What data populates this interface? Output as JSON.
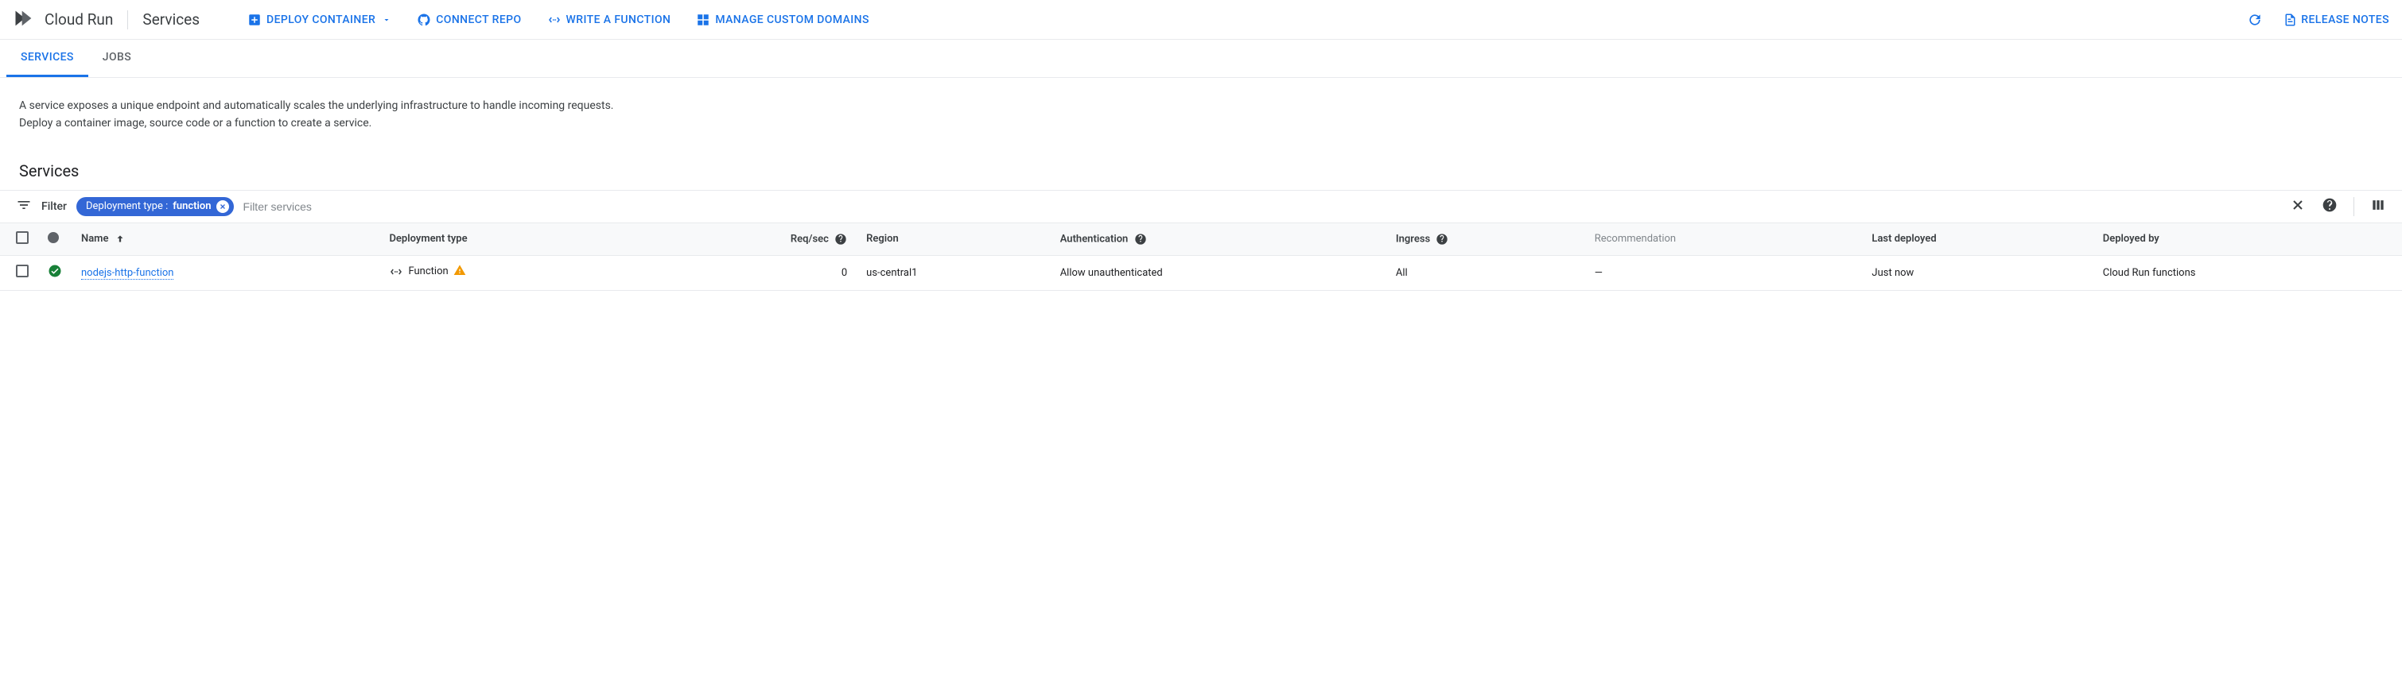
{
  "header": {
    "product": "Cloud Run",
    "page_title": "Services"
  },
  "toolbar": {
    "deploy": "DEPLOY CONTAINER",
    "connect_repo": "CONNECT REPO",
    "write_function": "WRITE A FUNCTION",
    "manage_domains": "MANAGE CUSTOM DOMAINS",
    "release_notes": "RELEASE NOTES"
  },
  "tabs": {
    "services": "SERVICES",
    "jobs": "JOBS"
  },
  "description": {
    "line1": "A service exposes a unique endpoint and automatically scales the underlying infrastructure to handle incoming requests.",
    "line2": "Deploy a container image, source code or a function to create a service."
  },
  "section_title": "Services",
  "filter": {
    "label": "Filter",
    "chip_key": "Deployment type",
    "chip_value": "function",
    "placeholder": "Filter services"
  },
  "columns": {
    "name": "Name",
    "deployment_type": "Deployment type",
    "req_sec": "Req/sec",
    "region": "Region",
    "authentication": "Authentication",
    "ingress": "Ingress",
    "recommendation": "Recommendation",
    "last_deployed": "Last deployed",
    "deployed_by": "Deployed by"
  },
  "rows": [
    {
      "name": "nodejs-http-function",
      "deployment_type": "Function",
      "req_sec": "0",
      "region": "us-central1",
      "authentication": "Allow unauthenticated",
      "ingress": "All",
      "recommendation": "—",
      "last_deployed": "Just now",
      "deployed_by": "Cloud Run functions"
    }
  ]
}
